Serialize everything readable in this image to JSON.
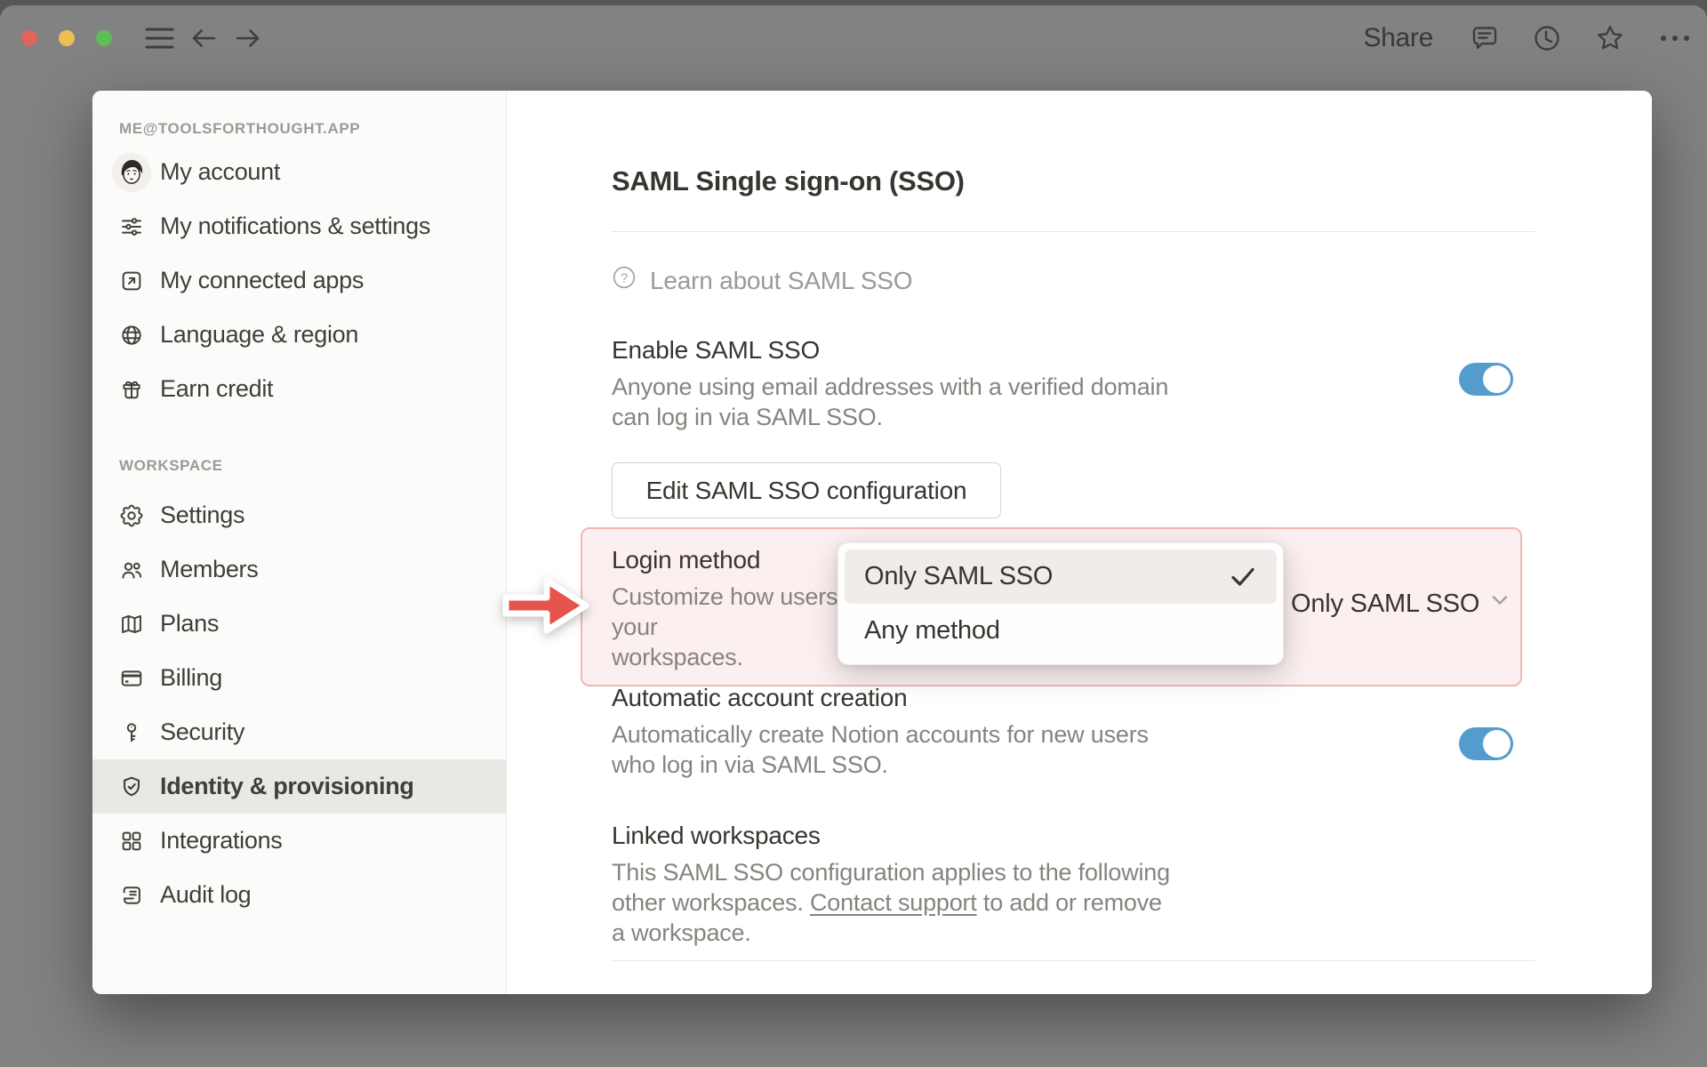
{
  "colors": {
    "toggle_on": "#549CCE",
    "highlight_border": "#EFB8B3",
    "highlight_bg": "#FBF0EF",
    "arrow_red": "#E5534B",
    "selected_row_bg": "#E9E8E5"
  },
  "titlebar": {
    "share_label": "Share"
  },
  "sidebar": {
    "account_header": "ME@TOOLSFORTHOUGHT.APP",
    "account_items": [
      {
        "icon": "avatar",
        "label": "My account"
      },
      {
        "icon": "sliders-icon",
        "label": "My notifications & settings"
      },
      {
        "icon": "connected-apps-icon",
        "label": "My connected apps"
      },
      {
        "icon": "globe-icon",
        "label": "Language & region"
      },
      {
        "icon": "gift-icon",
        "label": "Earn credit"
      }
    ],
    "workspace_header": "WORKSPACE",
    "workspace_items": [
      {
        "icon": "gear-icon",
        "label": "Settings",
        "selected": false
      },
      {
        "icon": "members-icon",
        "label": "Members",
        "selected": false
      },
      {
        "icon": "map-icon",
        "label": "Plans",
        "selected": false
      },
      {
        "icon": "credit-card-icon",
        "label": "Billing",
        "selected": false
      },
      {
        "icon": "key-icon",
        "label": "Security",
        "selected": false
      },
      {
        "icon": "shield-check-icon",
        "label": "Identity & provisioning",
        "selected": true
      },
      {
        "icon": "grid-icon",
        "label": "Integrations",
        "selected": false
      },
      {
        "icon": "scroll-icon",
        "label": "Audit log",
        "selected": false
      }
    ]
  },
  "main": {
    "title": "SAML Single sign-on (SSO)",
    "learn_link": "Learn about SAML SSO",
    "enable_sso": {
      "heading": "Enable SAML SSO",
      "description": "Anyone using email addresses with a verified domain\ncan log in via SAML SSO.",
      "toggle_on": true
    },
    "edit_button_label": "Edit SAML SSO configuration",
    "login_method": {
      "heading": "Login method",
      "description": "Customize how users are allowed to log in to your\nworkspaces.",
      "selected_value": "Only SAML SSO"
    },
    "login_method_dropdown": {
      "options": [
        {
          "label": "Only SAML SSO",
          "checked": true
        },
        {
          "label": "Any method",
          "checked": false
        }
      ]
    },
    "auto_account": {
      "heading": "Automatic account creation",
      "description": "Automatically create Notion accounts for new users\nwho log in via SAML SSO.",
      "toggle_on": true
    },
    "linked_workspaces": {
      "heading": "Linked workspaces",
      "description_before": "This SAML SSO configuration applies to the following\nother workspaces. ",
      "link_text": "Contact support",
      "description_after": " to add or remove\na workspace."
    }
  }
}
